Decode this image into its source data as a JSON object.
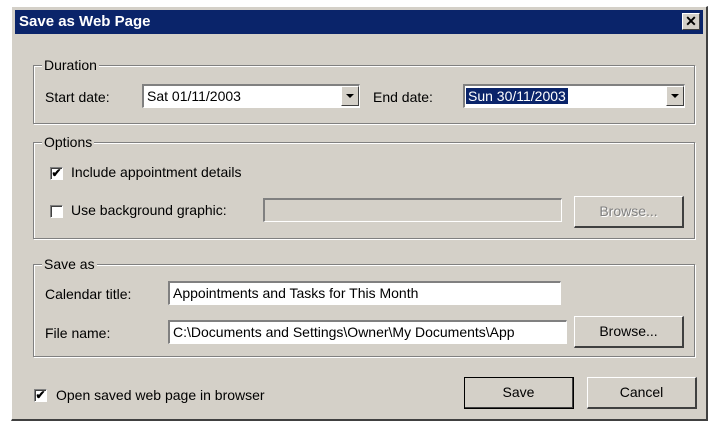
{
  "window": {
    "title": "Save as Web Page",
    "close_glyph": "✕"
  },
  "duration": {
    "legend": "Duration",
    "start_label": "Start date:",
    "start_value": "Sat 01/11/2003",
    "end_label": "End date:",
    "end_value": "Sun 30/11/2003"
  },
  "options": {
    "legend": "Options",
    "include_details_label": "Include appointment details",
    "include_details_checked": true,
    "bg_graphic_label": "Use background graphic:",
    "bg_graphic_checked": false,
    "bg_graphic_value": "",
    "browse_label": "Browse..."
  },
  "save_as": {
    "legend": "Save as",
    "calendar_title_label": "Calendar title:",
    "calendar_title_value": "Appointments and Tasks for This Month",
    "file_name_label": "File name:",
    "file_name_value": "C:\\Documents and Settings\\Owner\\My Documents\\App",
    "browse_label": "Browse..."
  },
  "footer": {
    "open_in_browser_label": "Open saved web page in browser",
    "open_in_browser_checked": true,
    "save_label": "Save",
    "cancel_label": "Cancel"
  },
  "icons": {
    "check_glyph": "✔",
    "close": "close-icon",
    "dropdown": "chevron-down-icon"
  }
}
